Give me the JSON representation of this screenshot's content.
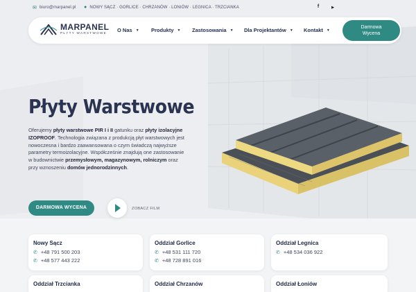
{
  "topbar": {
    "email": "biuro@marpanel.pl",
    "locations": "NOWY SĄCZ · GORLICE · CHRZANÓW · LONIÓW · LEGNICA · TRZCIANKA",
    "social": [
      "f",
      "▶"
    ]
  },
  "brand": {
    "name": "MARPANEL",
    "tagline": "PŁYTY WARSTWOWE"
  },
  "nav": {
    "items": [
      "O Nas",
      "Produkty",
      "Zastosowania",
      "Dla Projektantów",
      "Kontakt"
    ],
    "cta": "Darmowa Wycena"
  },
  "hero": {
    "title": "Płyty Warstwowe",
    "text_parts": [
      {
        "t": "Oferujemy ",
        "b": false
      },
      {
        "t": "płyty warstwowe PIR I i II",
        "b": true
      },
      {
        "t": " gatunku oraz ",
        "b": false
      },
      {
        "t": "płyty izolacyjne IZOPROOF",
        "b": true
      },
      {
        "t": ". Technologia związana z produkcją płyt warstwowych jest nowoczesna i bardzo zaawansowana o czym świadczą najwyższe parametry termoizolacyjne. Współcześnie znajdują one zastosowanie w budownictwie ",
        "b": false
      },
      {
        "t": "przemysłowym, magazynowym, rolniczym",
        "b": true
      },
      {
        "t": " oraz przy wznoszeniu ",
        "b": false
      },
      {
        "t": "domów jednorodzinnych",
        "b": true
      },
      {
        "t": ".",
        "b": false
      }
    ],
    "cta": "DARMOWA WYCENA",
    "video_label": "ZOBACZ FILM"
  },
  "branches": [
    {
      "name": "Nowy Sącz",
      "phones": [
        "+48 791 500 203",
        "+48 577 443 222"
      ]
    },
    {
      "name": "Oddział Gorlice",
      "phones": [
        "+48 531 111 720",
        "+48 728 891 016"
      ]
    },
    {
      "name": "Oddział Legnica",
      "phones": [
        "+48 534 036 922"
      ]
    },
    {
      "name": "Oddział Trzcianka",
      "phones": []
    },
    {
      "name": "Oddział Chrzanów",
      "phones": []
    },
    {
      "name": "Oddział Łoniów",
      "phones": []
    }
  ],
  "colors": {
    "accent": "#2f8a83",
    "navy": "#2a3350"
  },
  "icons": {
    "email": "envelope-icon",
    "location": "map-pin-icon",
    "phone": "phone-icon",
    "play": "play-icon"
  }
}
